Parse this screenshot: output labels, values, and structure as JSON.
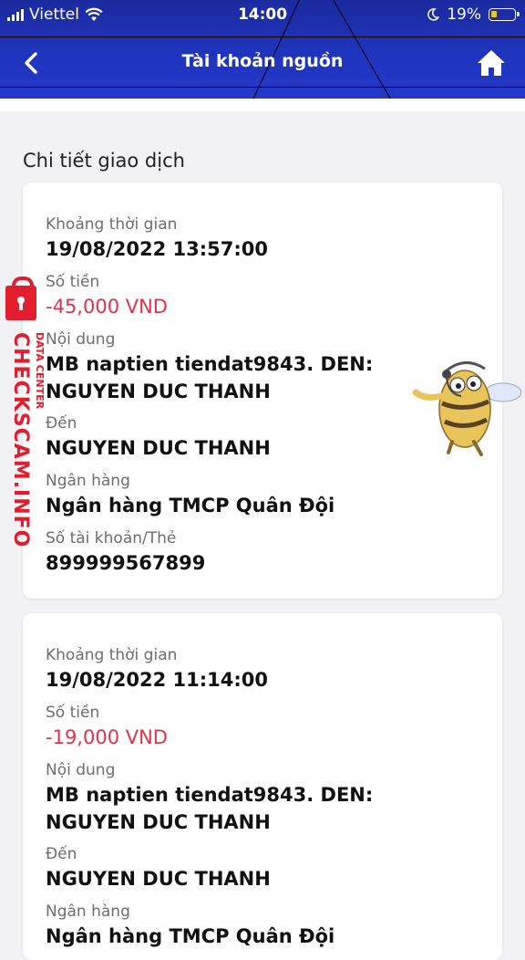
{
  "status_bar": {
    "carrier": "Viettel",
    "time": "14:00",
    "battery": "19%"
  },
  "nav": {
    "title": "Tài khoản nguồn"
  },
  "section_title": "Chi tiết giao dịch",
  "transactions": [
    {
      "time_label": "Khoảng thời gian",
      "time": "19/08/2022 13:57:00",
      "amount_label": "Số tiền",
      "amount": "-45,000 VND",
      "content_label": "Nội dung",
      "content_line1": "MB naptien tiendat9843. DEN:",
      "content_line2": "NGUYEN DUC THANH",
      "to_label": "Đến",
      "to": "NGUYEN DUC THANH",
      "bank_label": "Ngân hàng",
      "bank": "Ngân hàng TMCP Quân Đội",
      "account_label": "Số tài khoản/Thẻ",
      "account": "899999567899"
    },
    {
      "time_label": "Khoảng thời gian",
      "time": "19/08/2022 11:14:00",
      "amount_label": "Số tiền",
      "amount": "-19,000 VND",
      "content_label": "Nội dung",
      "content_line1": "MB naptien tiendat9843. DEN:",
      "content_line2": "NGUYEN DUC THANH",
      "to_label": "Đến",
      "to": "NGUYEN DUC THANH",
      "bank_label": "Ngân hàng",
      "bank": "Ngân hàng TMCP Quân Đội"
    }
  ],
  "watermark": {
    "main": "CHECKSCAM.INFO",
    "sub": "DATA CENTER"
  },
  "icons": {
    "back": "chevron-left-icon",
    "home": "home-icon",
    "wifi": "wifi-icon",
    "moon": "moon-icon",
    "lock": "lock-icon"
  },
  "colors": {
    "header": "#1f35c0",
    "amount": "#e0324b",
    "watermark": "#e11d2e"
  }
}
